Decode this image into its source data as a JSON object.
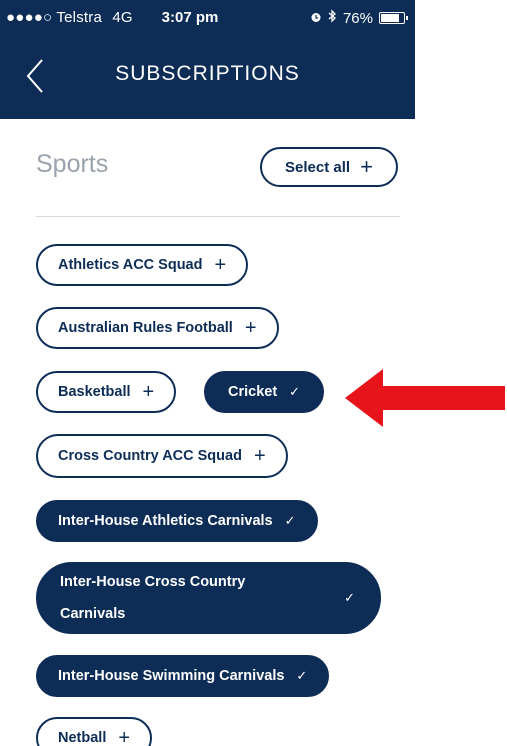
{
  "status_bar": {
    "signal": "●●●●○",
    "carrier": "Telstra",
    "network": "4G",
    "time": "3:07 pm",
    "battery": "76%",
    "battery_level": 0.76
  },
  "header": {
    "title": "SUBSCRIPTIONS",
    "back_icon": "chevron-left-icon"
  },
  "section": {
    "title": "Sports",
    "select_all_label": "Select all",
    "plus_symbol": "+"
  },
  "subscriptions": [
    {
      "label": "Athletics ACC Squad",
      "selected": false,
      "indicator": "+"
    },
    {
      "label": "Australian Rules Football",
      "selected": false,
      "indicator": "+"
    },
    {
      "label": "Basketball",
      "selected": false,
      "indicator": "+"
    },
    {
      "label": "Cricket",
      "selected": true,
      "indicator": "✓"
    },
    {
      "label": "Cross Country ACC Squad",
      "selected": false,
      "indicator": "+"
    },
    {
      "label": "Inter-House Athletics Carnivals",
      "selected": true,
      "indicator": "✓"
    },
    {
      "label": "Inter-House Cross Country Carnivals",
      "selected": true,
      "indicator": "✓"
    },
    {
      "label": "Inter-House Swimming Carnivals",
      "selected": true,
      "indicator": "✓"
    },
    {
      "label": "Netball",
      "selected": false,
      "indicator": "+"
    }
  ],
  "colors": {
    "navy": "#0d2d57",
    "annotation_arrow": "#e8141b"
  }
}
